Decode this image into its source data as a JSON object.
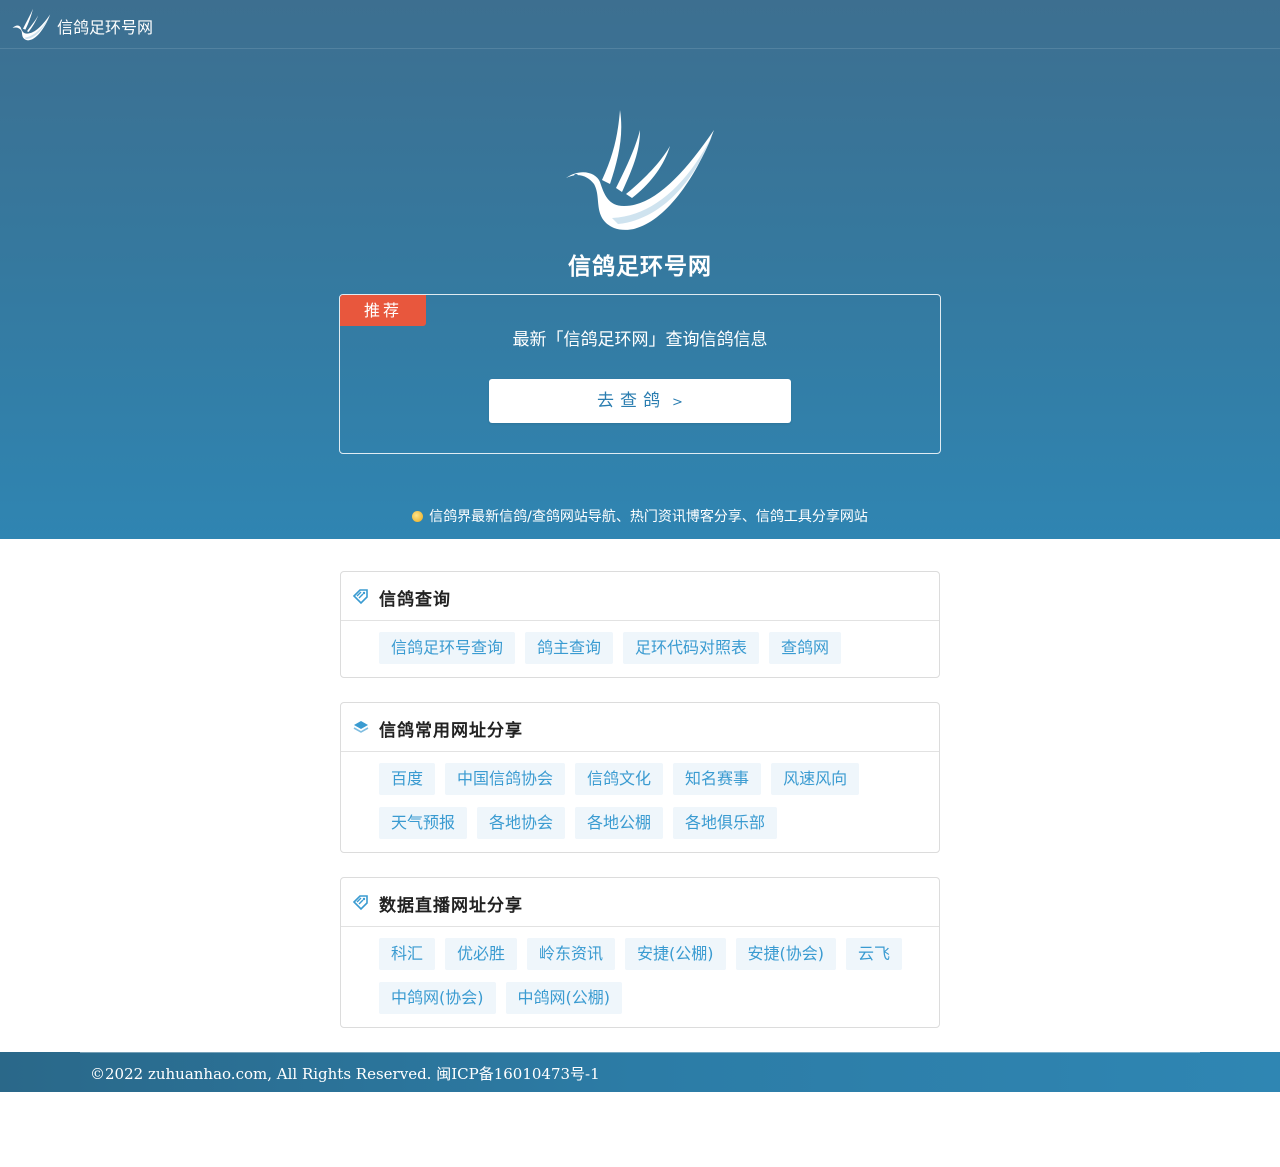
{
  "header": {
    "site_name": "信鸽足环号网",
    "logo_icon": "dove-icon"
  },
  "hero": {
    "title": "信鸽足环号网",
    "logo_icon": "dove-icon",
    "recommend": {
      "badge": "推荐",
      "text": "最新「信鸽足环网」查询信鸽信息",
      "button_label": "去查鸽",
      "button_chevron": ">"
    },
    "tagline": "信鸽界最新信鸽/查鸽网站导航、热门资讯博客分享、信鸽工具分享网站",
    "tagline_icon": "lightbulb-icon"
  },
  "sections": [
    {
      "title": "信鸽查询",
      "icon": "tag-icon",
      "links": [
        "信鸽足环号查询",
        "鸽主查询",
        "足环代码对照表",
        "查鸽网"
      ]
    },
    {
      "title": "信鸽常用网址分享",
      "icon": "layers-icon",
      "links": [
        "百度",
        "中国信鸽协会",
        "信鸽文化",
        "知名赛事",
        "风速风向",
        "天气预报",
        "各地协会",
        "各地公棚",
        "各地俱乐部"
      ]
    },
    {
      "title": "数据直播网址分享",
      "icon": "tag-icon",
      "links": [
        "科汇",
        "优必胜",
        "岭东资讯",
        "安捷(公棚)",
        "安捷(协会)",
        "云飞",
        "中鸽网(协会)",
        "中鸽网(公棚)"
      ]
    }
  ],
  "footer": {
    "copyright": "©2022 zuhuanhao.com, All Rights Reserved. 闽ICP备16010473号-1"
  },
  "colors": {
    "accent": "#2f85b2",
    "badge": "#e8573d",
    "tag_bg": "#eff6fb",
    "tag_text": "#3a9bd1"
  }
}
